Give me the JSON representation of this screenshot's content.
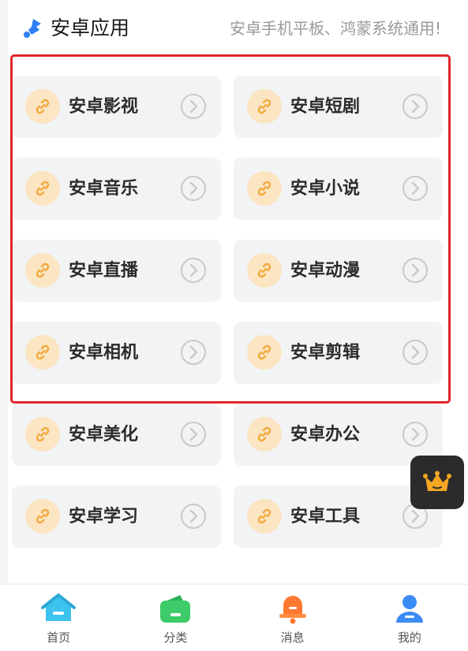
{
  "header": {
    "title": "安卓应用",
    "subtitle": "安卓手机平板、鸿蒙系统通用!",
    "icon": "puzzle-icon"
  },
  "items": [
    {
      "label": "安卓影视"
    },
    {
      "label": "安卓短剧"
    },
    {
      "label": "安卓音乐"
    },
    {
      "label": "安卓小说"
    },
    {
      "label": "安卓直播"
    },
    {
      "label": "安卓动漫"
    },
    {
      "label": "安卓相机"
    },
    {
      "label": "安卓剪辑"
    },
    {
      "label": "安卓美化"
    },
    {
      "label": "安卓办公"
    },
    {
      "label": "安卓学习"
    },
    {
      "label": "安卓工具"
    }
  ],
  "floating_button": {
    "icon": "crown-icon",
    "color": "#f5a623"
  },
  "tabbar": [
    {
      "label": "首页",
      "icon": "home-icon",
      "color": "#3ec2ee"
    },
    {
      "label": "分类",
      "icon": "wallet-icon",
      "color": "#3ecb6a"
    },
    {
      "label": "消息",
      "icon": "bell-icon",
      "color": "#ff7a30"
    },
    {
      "label": "我的",
      "icon": "user-icon",
      "color": "#3b8cf5"
    }
  ],
  "colors": {
    "highlight": "#e0262b",
    "link_icon_bg": "#fbe5c2",
    "link_icon_fg": "#f2a93b",
    "card_bg": "#f2f3f5"
  }
}
